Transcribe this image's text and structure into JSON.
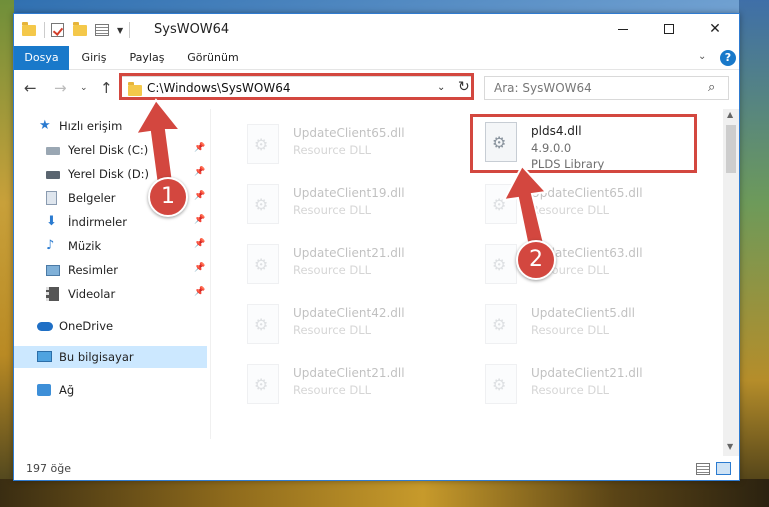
{
  "window": {
    "title": "SysWOW64",
    "accent_color": "#1979ca"
  },
  "ribbon": {
    "tabs": [
      "Dosya",
      "Giriş",
      "Paylaş",
      "Görünüm"
    ],
    "help": "?"
  },
  "toolbar": {
    "back_icon": "←",
    "forward_icon": "→",
    "dropdown_icon": "⌄",
    "up_icon": "↑"
  },
  "address": {
    "path": "C:\\Windows\\SysWOW64",
    "refresh_icon": "↻",
    "dropdown_icon": "⌄"
  },
  "search": {
    "placeholder": "Ara: SysWOW64",
    "icon": "⌕"
  },
  "navpane": {
    "quick_access": "Hızlı erişim",
    "items": [
      {
        "label": "Yerel Disk (C:)",
        "icon": "drive-icon",
        "pinned": true
      },
      {
        "label": "Yerel Disk (D:)",
        "icon": "drive-icon",
        "pinned": true
      },
      {
        "label": "Belgeler",
        "icon": "documents-icon",
        "pinned": true
      },
      {
        "label": "İndirmeler",
        "icon": "downloads-icon",
        "pinned": true
      },
      {
        "label": "Müzik",
        "icon": "music-icon",
        "pinned": true
      },
      {
        "label": "Resimler",
        "icon": "pictures-icon",
        "pinned": true
      },
      {
        "label": "Videolar",
        "icon": "videos-icon",
        "pinned": true
      }
    ],
    "onedrive": "OneDrive",
    "this_pc": "Bu bilgisayar",
    "network": "Ağ"
  },
  "files": {
    "highlighted": {
      "name": "plds4.dll",
      "version": "4.9.0.0",
      "description": "PLDS Library"
    },
    "background": [
      {
        "name": "UpdateClient65.dll",
        "type": "Resource DLL"
      },
      {
        "name": "UpdateClient19.dll",
        "type": "Resource DLL"
      },
      {
        "name": "UpdateClient65.dll",
        "type": "Resource DLL"
      },
      {
        "name": "UpdateClient21.dll",
        "type": "Resource DLL"
      },
      {
        "name": "UpdateClient63.dll",
        "type": "Resource DLL"
      },
      {
        "name": "UpdateClient42.dll",
        "type": "Resource DLL"
      },
      {
        "name": "UpdateClient5.dll",
        "type": "Resource DLL"
      },
      {
        "name": "UpdateClient21.dll",
        "type": "Resource DLL"
      },
      {
        "name": "UpdateClient21.dll",
        "type": "Resource DLL"
      }
    ]
  },
  "status": {
    "item_count": "197 öğe"
  },
  "callouts": {
    "step1": "1",
    "step2": "2",
    "color": "#d3473f"
  }
}
